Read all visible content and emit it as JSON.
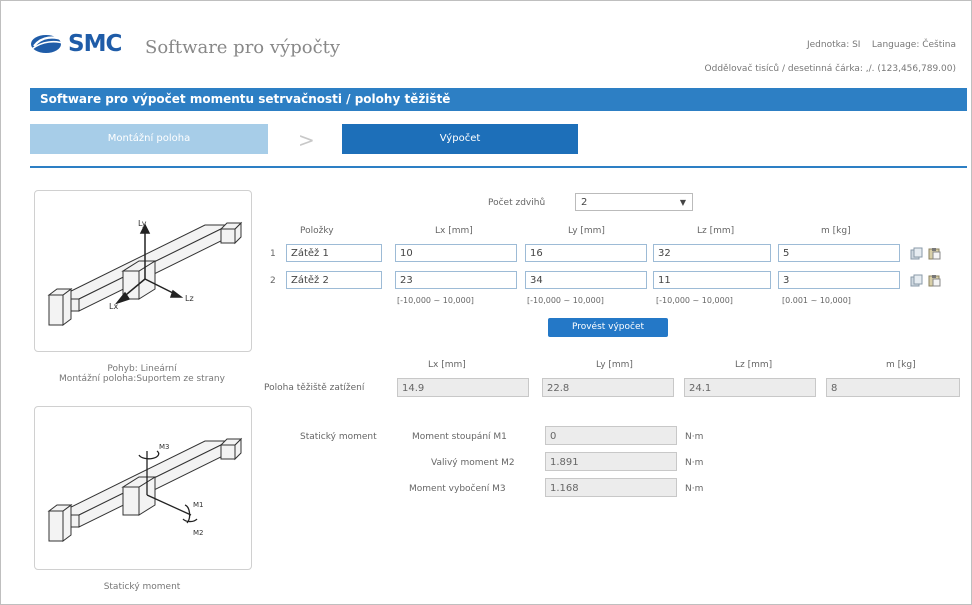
{
  "header": {
    "brand": "SMC",
    "app_title": "Software pro výpočty",
    "unit_label": "Jednotka: SI",
    "language_label": "Language: Čeština",
    "separator_label": "Oddělovač tisíců / desetinná čárka:  ,/.  (123,456,789.00)"
  },
  "title_bar": "Software pro výpočet momentu setrvačnosti / polohy těžiště",
  "steps": {
    "step1": "Montážní poloha",
    "step2": "Výpočet"
  },
  "left_panel": {
    "top_caption_line1": "Pohyb: Lineární",
    "top_caption_line2": "Montážní poloha:Suportem ze strany",
    "bottom_caption": "Statický moment",
    "top_axes": {
      "ly": "Ly",
      "lz": "Lz",
      "lx": "Lx"
    },
    "bottom_axes": {
      "m3": "M3",
      "m1": "M1",
      "m2": "M2"
    }
  },
  "form": {
    "count_label": "Počet zdvihů",
    "count_value": "2",
    "columns": {
      "items": "Položky",
      "lx": "Lx [mm]",
      "ly": "Ly [mm]",
      "lz": "Lz [mm]",
      "m": "m [kg]"
    },
    "rows": [
      {
        "num": "1",
        "name": "Zátěž 1",
        "lx": "10",
        "ly": "16",
        "lz": "32",
        "m": "5"
      },
      {
        "num": "2",
        "name": "Zátěž 2",
        "lx": "23",
        "ly": "34",
        "lz": "11",
        "m": "3"
      }
    ],
    "ranges": {
      "lx": "[-10,000 ~ 10,000]",
      "ly": "[-10,000 ~ 10,000]",
      "lz": "[-10,000 ~ 10,000]",
      "m": "[0.001 ~ 10,000]"
    },
    "calc_button": "Provést výpočet"
  },
  "results": {
    "cog_label": "Poloha těžiště zatížení",
    "cols": {
      "lx": "Lx [mm]",
      "ly": "Ly [mm]",
      "lz": "Lz [mm]",
      "m": "m [kg]"
    },
    "cog": {
      "lx": "14.9",
      "ly": "22.8",
      "lz": "24.1",
      "m": "8"
    },
    "static_label": "Statický moment",
    "moments": [
      {
        "label": "Moment stoupání M1",
        "value": "0",
        "unit": "N·m"
      },
      {
        "label": "Valivý moment M2",
        "value": "1.891",
        "unit": "N·m"
      },
      {
        "label": "Moment vybočení M3",
        "value": "1.168",
        "unit": "N·m"
      }
    ]
  }
}
